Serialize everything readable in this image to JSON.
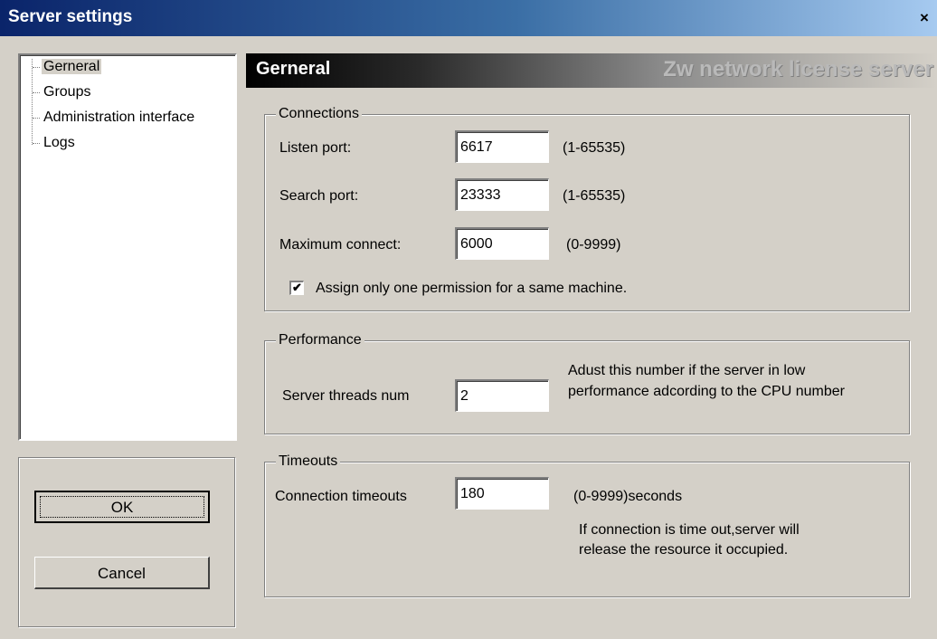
{
  "window": {
    "title": "Server settings",
    "close_glyph": "×"
  },
  "tree": {
    "items": [
      {
        "label": "Gerneral",
        "selected": true
      },
      {
        "label": "Groups"
      },
      {
        "label": "Administration interface"
      },
      {
        "label": "Logs"
      }
    ]
  },
  "buttons": {
    "ok": "OK",
    "cancel": "Cancel"
  },
  "header": {
    "title": "Gerneral",
    "brand": "Zw network license server"
  },
  "connections": {
    "legend": "Connections",
    "listen_port": {
      "label": "Listen port:",
      "value": "6617",
      "range": "(1-65535)"
    },
    "search_port": {
      "label": "Search port:",
      "value": "23333",
      "range": "(1-65535)"
    },
    "max_connect": {
      "label": "Maximum connect:",
      "value": "6000",
      "range": "(0-9999)"
    },
    "assign_one": {
      "label": "Assign only one permission for a same machine.",
      "checked": true,
      "check_glyph": "✔"
    }
  },
  "performance": {
    "legend": "Performance",
    "threads": {
      "label": "Server threads num",
      "value": "2"
    },
    "hint_line1": "Adust this number if the server in low",
    "hint_line2": "performance adcording to the CPU number"
  },
  "timeouts": {
    "legend": "Timeouts",
    "connection": {
      "label": "Connection timeouts",
      "value": "180",
      "range": "(0-9999)seconds"
    },
    "hint_line1": "If connection is time out,server will",
    "hint_line2": "release the resource it occupied."
  }
}
